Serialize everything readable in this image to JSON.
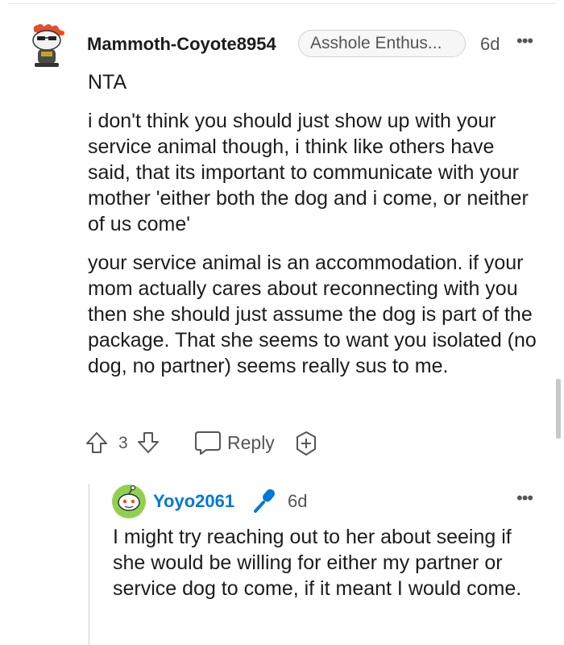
{
  "comment": {
    "author": "Mammoth-Coyote8954",
    "flair": "Asshole Enthus...",
    "time": "6d",
    "more": "•••",
    "paragraphs": [
      "NTA",
      "i don't think you should just show up with your service animal though, i think like others have said, that its important to communicate with your mother 'either both the dog and i come, or neither of us come'",
      "your service animal is an accommodation. if your mom actually cares about reconnecting with you then she should just assume the dog is part of the package. That she seems to want you isolated (no dog, no partner) seems really sus to me."
    ],
    "vote_count": "3",
    "reply_label": "Reply"
  },
  "reply": {
    "author": "Yoyo2061",
    "time": "6d",
    "more": "•••",
    "text": "I might try reaching out to her about seeing if she would be willing for either my partner or service dog to come, if it meant I would come."
  },
  "colors": {
    "username_reply": "#0079d3",
    "mic_icon": "#0079d3",
    "avatar_green": "#8fd14f",
    "text": "#1c1c1c",
    "muted": "#555555"
  },
  "icons": [
    "snoo-avatar-icon",
    "upvote-icon",
    "downvote-icon",
    "reply-bubble-icon",
    "award-plus-icon",
    "microphone-icon"
  ]
}
